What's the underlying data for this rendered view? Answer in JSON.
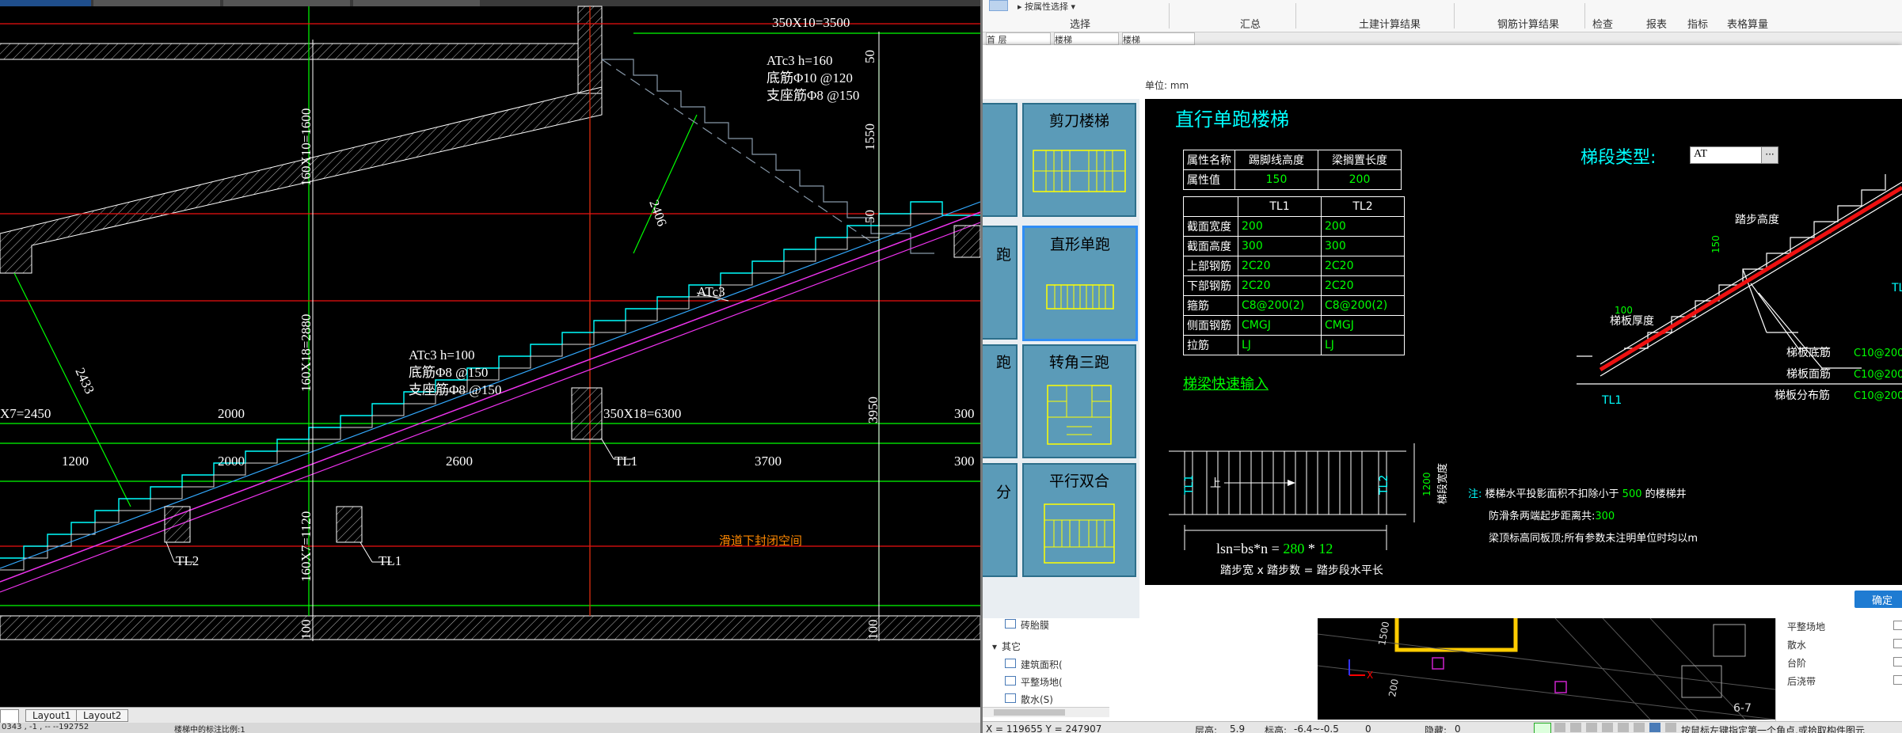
{
  "cad": {
    "tabs": [
      "",
      "",
      "",
      ""
    ],
    "dims_top": "350X10=3500",
    "label_atc3_top": "ATc3",
    "label_h160": "ATc3  h=160",
    "label_bottom_rebar_160": "底筋Φ10 @120",
    "label_support_160": "支座筋Φ8 @150",
    "dim_1550": "1550",
    "dim_50a": "50",
    "dim_50b": "50",
    "dim_2406": "2406",
    "label_atc3_mid": "ATc3",
    "label_h100": "ATc3  h=100",
    "label_bottom_rebar_100": "底筋Φ8 @150",
    "label_support_100": "支座筋Φ8 @150",
    "dim_160x10": "160X10=1600",
    "dim_160x18": "160X18=2880",
    "dim_160x7": "160X7=1120",
    "dim_2433": "2433",
    "dim_350x18": "350X18=6300",
    "dim_x7": "X7=2450",
    "dim_2000a": "2000",
    "dim_3950": "3950",
    "dim_300a": "300",
    "dim_1200": "1200",
    "dim_2000b": "2000",
    "dim_2600": "2600",
    "dim_3700": "3700",
    "dim_300b": "300",
    "label_tl1a": "TL1",
    "label_tl1b": "TL1",
    "label_tl2": "TL2",
    "label_note": "滑道下封闭空间",
    "dim_100a": "100",
    "dim_100b": "100",
    "layout_tabs": [
      "Layout1",
      "Layout2"
    ],
    "status_coords": "0343 , -1 , -- --192752",
    "status_text": "楼梯中的标注比例:1"
  },
  "ribbon": {
    "dropdown": "按属性选择",
    "groups": [
      "选择",
      "汇总",
      "土建计算结果",
      "钢筋计算结果",
      "检查",
      "报表",
      "指标",
      "表格算量"
    ],
    "row2": [
      "首 层",
      "楼梯",
      "楼梯"
    ]
  },
  "dialog": {
    "unit": "单位:  mm",
    "title": "直行单跑楼梯",
    "thumbs": [
      "剪刀楼梯",
      "直形单跑",
      "转角三跑",
      "平行双合"
    ],
    "thumbs_left_partial": [
      "",
      "跑",
      "跑",
      "分"
    ],
    "attr_table": {
      "headers": [
        "属性名称",
        "踢脚线高度",
        "梁搁置长度"
      ],
      "row": [
        "属性值",
        "150",
        "200"
      ]
    },
    "beam_table": {
      "headers": [
        "",
        "TL1",
        "TL2"
      ],
      "rows": [
        [
          "截面宽度",
          "200",
          "200"
        ],
        [
          "截面高度",
          "300",
          "300"
        ],
        [
          "上部钢筋",
          "2C20",
          "2C20"
        ],
        [
          "下部钢筋",
          "2C20",
          "2C20"
        ],
        [
          "箍筋",
          "C8@200(2)",
          "C8@200(2)"
        ],
        [
          "侧面钢筋",
          "CMGJ",
          "CMGJ"
        ],
        [
          "拉筋",
          "LJ",
          "LJ"
        ]
      ]
    },
    "quick_input": "梯梁快速输入",
    "segment_type_label": "梯段类型:",
    "segment_type_value": "AT",
    "plan_label_tl1": "TL1",
    "plan_label_tl2": "TL2",
    "plan_label_up": "上",
    "plan_dim_1200": "1200",
    "plan_width_label": "梯段宽度",
    "formula_prefix": "lsn=bs*n = ",
    "formula_bs": "280",
    "formula_star": " * ",
    "formula_n": "12",
    "formula_caption": "踏步宽 x 踏步数 = 踏步段水平长",
    "section": {
      "step_height": "踏步高度",
      "dim_150": "150",
      "dim_100": "100",
      "slab_thickness": "梯板厚度",
      "label_tl1": "TL1",
      "label_tl_top": "TL",
      "bottom_rebar": "梯板底筋",
      "bottom_rebar_val": "C10@200",
      "top_rebar": "梯板面筋",
      "top_rebar_val": "C10@200",
      "dist_rebar": "梯板分布筋",
      "dist_rebar_val": "C10@200"
    },
    "notes": {
      "prefix": "注:",
      "line1a": "楼梯水平投影面积不扣除小于 ",
      "line1b": "500",
      "line1c": " 的楼梯井",
      "line2a": "防滑条两端起步距离共:",
      "line2b": "300",
      "line3": "梁顶标高同板顶;所有参数未注明单位时均以m"
    },
    "ok_button": "确定"
  },
  "tree": {
    "items": [
      "砖胎膜",
      "其它",
      "建筑面积(",
      "平整场地(",
      "散水(S)"
    ]
  },
  "props_panel": {
    "items": [
      "平整场地",
      "散水",
      "台阶",
      "后浇带"
    ]
  },
  "bottom_right": {
    "status_coords": "X = 119655 Y = 247907",
    "floor_height_label": "层高:",
    "floor_height": "5.9",
    "elevation_label": "标高:",
    "elevation": "-6.4~-0.5",
    "zero": "0",
    "hidden_label": "隐藏:",
    "hidden": "0",
    "hint": "按鼠标左键指定第一个角点,或拾取构件图元",
    "view_labels": [
      "1500",
      "200",
      "6-7"
    ]
  },
  "colors": {
    "cad_bg": "#000000",
    "dialog_bg": "#000000",
    "thumb_bg": "#5b9bb8",
    "accent": "#1e7bd2"
  }
}
